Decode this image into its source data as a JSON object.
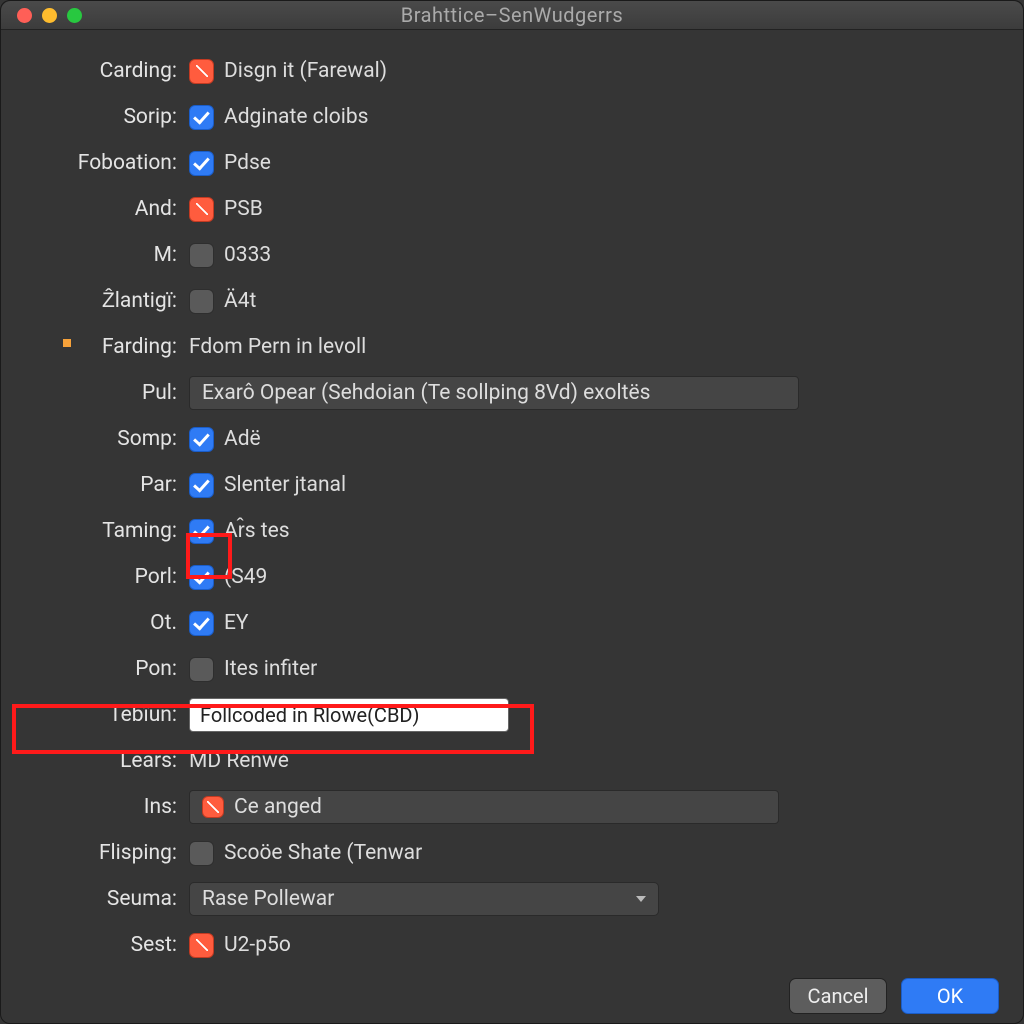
{
  "window": {
    "title": "Brahttice–SenWudgerrs"
  },
  "rows": {
    "carding": {
      "label": "Carding:",
      "value": "Disgn it (Farewal)"
    },
    "sorip": {
      "label": "Sorip:",
      "value": "Adginate cloibs"
    },
    "foboation": {
      "label": "Foboation:",
      "value": "Pdse"
    },
    "and": {
      "label": "And:",
      "value": "PSB"
    },
    "m": {
      "label": "M:",
      "value": "0333"
    },
    "zlantigi": {
      "label": "Ẑlantigï:",
      "value": "Ä4t"
    },
    "farding": {
      "label": "Farding:",
      "value": "Fdom Pern in levoll"
    },
    "pul": {
      "label": "Pul:",
      "value": "Exarô Opear (Sehdoian (Te sollping 8Vd) exoltës"
    },
    "somp": {
      "label": "Somp:",
      "value": "Adë"
    },
    "par": {
      "label": "Par:",
      "value": "Slenter jtanal"
    },
    "taming": {
      "label": "Taming:",
      "value": "Ar̂s tes"
    },
    "porl": {
      "label": "Porl:",
      "value": "(S49"
    },
    "ot": {
      "label": "Ot.",
      "value": "EY"
    },
    "pon": {
      "label": "Pon:",
      "value": "Ites infiter"
    },
    "tebiun": {
      "label": "Tebïun:",
      "value": "Follcoded in Rlowe(CBD)"
    },
    "lears": {
      "label": "Lears:",
      "value": "MD Renwė"
    },
    "ins": {
      "label": "Ins:",
      "value": "Ce anged"
    },
    "flisping": {
      "label": "Flisping:",
      "value": "Scoöe Shate (Tenwar"
    },
    "seuma": {
      "label": "Seuma:",
      "value": "Rase Pollewar"
    },
    "sest": {
      "label": "Sest:",
      "value": "U2-p5o"
    }
  },
  "footer": {
    "cancel": "Cancel",
    "ok": "OK"
  }
}
